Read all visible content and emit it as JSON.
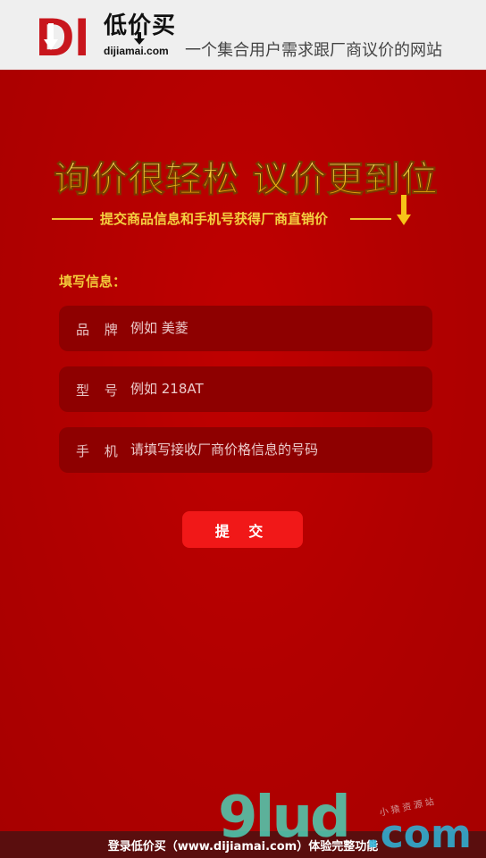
{
  "header": {
    "logo_letters": "DI",
    "logo_name": "低价买",
    "logo_domain": "dijiamai.com",
    "slogan": "一个集合用户需求跟厂商议价的网站"
  },
  "hero": {
    "headline": "询价很轻松 议价更到位",
    "subtitle": "提交商品信息和手机号获得厂商直销价"
  },
  "form": {
    "section_label": "填写信息：",
    "fields": [
      {
        "label": "品 牌",
        "placeholder": "例如 美菱"
      },
      {
        "label": "型 号",
        "placeholder": "例如 218AT"
      },
      {
        "label": "手 机",
        "placeholder": "请填写接收厂商价格信息的号码"
      }
    ],
    "submit_label": "提 交"
  },
  "footer": {
    "text": "登录低价买（www.dijiamai.com）体验完整功能"
  },
  "watermark": {
    "brand": "9lud",
    "suffix": ".com",
    "tagline": "小猿资源站"
  },
  "colors": {
    "background": "#b30000",
    "field_bg": "#8e0000",
    "accent_gold": "#f2c83a",
    "button": "#f11818",
    "header_bg": "#efefef"
  }
}
